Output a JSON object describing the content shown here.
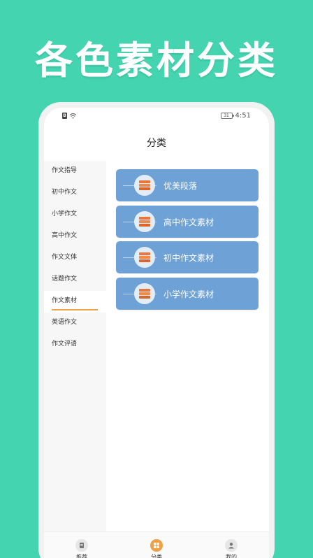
{
  "promo": {
    "title": "各色素材分类"
  },
  "status_bar": {
    "sim": "B",
    "battery": "31",
    "time": "4:51"
  },
  "header": {
    "title": "分类"
  },
  "sidebar": {
    "items": [
      {
        "label": "作文指导"
      },
      {
        "label": "初中作文"
      },
      {
        "label": "小学作文"
      },
      {
        "label": "高中作文"
      },
      {
        "label": "作文文体"
      },
      {
        "label": "话题作文"
      },
      {
        "label": "作文素材",
        "active": true
      },
      {
        "label": "英语作文"
      },
      {
        "label": "作文评语"
      }
    ]
  },
  "categories": [
    {
      "label": "优美段落",
      "icon": "book-stack-icon"
    },
    {
      "label": "高中作文素材",
      "icon": "book-stack-icon"
    },
    {
      "label": "初中作文素材",
      "icon": "book-stack-icon"
    },
    {
      "label": "小学作文素材",
      "icon": "book-stack-icon"
    }
  ],
  "tabbar": {
    "items": [
      {
        "label": "推荐",
        "icon": "recommend-icon"
      },
      {
        "label": "分类",
        "icon": "category-icon",
        "active": true
      },
      {
        "label": "我的",
        "icon": "profile-icon"
      }
    ]
  },
  "colors": {
    "background": "#45d4b0",
    "card": "#6ea1d5",
    "accent": "#f0a044",
    "icon_orange": "#e8763c"
  }
}
